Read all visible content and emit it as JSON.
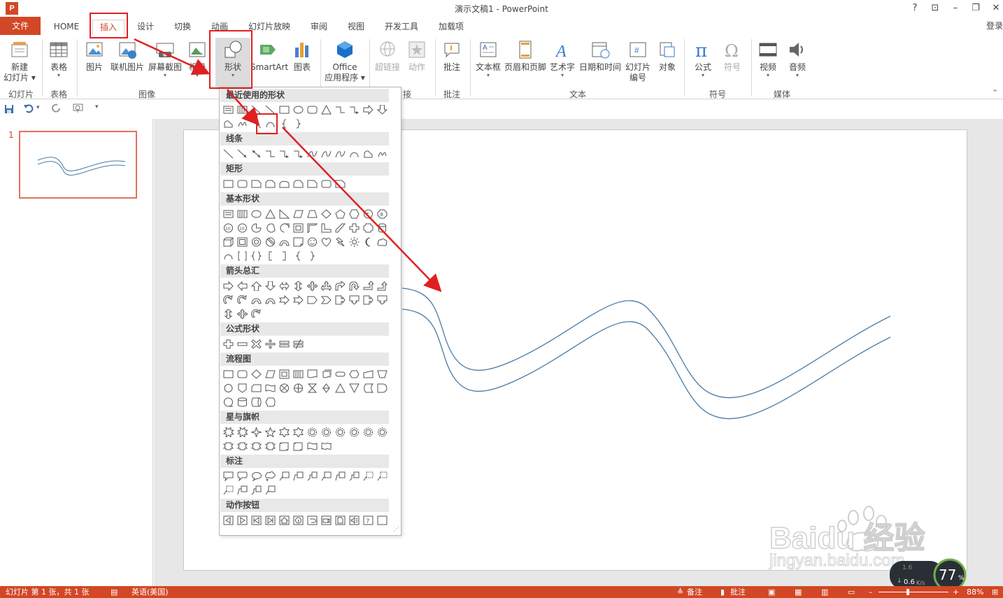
{
  "window": {
    "title": "演示文稿1 - PowerPoint",
    "help": "?",
    "restore_ribbon": "⊡",
    "minimize": "–",
    "maximize": "❐",
    "close": "✕"
  },
  "tabs": {
    "file": "文件",
    "home": "HOME",
    "insert": "插入",
    "design": "设计",
    "transitions": "切换",
    "animations": "动画",
    "slideshow": "幻灯片放映",
    "review": "审阅",
    "view": "视图",
    "developer": "开发工具",
    "addins": "加载项",
    "login": "登录"
  },
  "ribbon": {
    "new_slide": "新建",
    "new_slide2": "幻灯片 ▾",
    "table": "表格",
    "picture": "图片",
    "online_picture": "联机图片",
    "screenshot": "屏幕截图",
    "album": "相册",
    "shapes": "形状",
    "smartart": "SmartArt",
    "chart": "图表",
    "office": "Office",
    "office2": "应用程序 ▾",
    "hyperlink": "超链接",
    "action": "动作",
    "comment": "批注",
    "textbox": "文本框",
    "header_footer": "页眉和页脚",
    "wordart": "艺术字",
    "datetime": "日期和时间",
    "slide_number": "幻灯片",
    "slide_number2": "编号",
    "object": "对象",
    "equation": "公式",
    "symbol": "符号",
    "video": "视频",
    "audio": "音频",
    "groups": {
      "slides": "幻灯片",
      "tables": "表格",
      "images": "图像",
      "links": "接",
      "comments": "批注",
      "text": "文本",
      "symbols": "符号",
      "media": "媒体"
    }
  },
  "shapes_menu": {
    "sections": {
      "recent": "最近使用的形状",
      "lines": "线条",
      "rect": "矩形",
      "basic": "基本形状",
      "arrows": "箭头总汇",
      "equation": "公式形状",
      "flowchart": "流程图",
      "stars": "星与旗帜",
      "callouts": "标注",
      "action": "动作按钮"
    }
  },
  "thumbnail": {
    "number": "1"
  },
  "status": {
    "slide_info": "幻灯片 第 1 张，共 1 张",
    "language": "英语(美国)",
    "notes": "备注",
    "comments": "批注",
    "zoom": "88%"
  },
  "badge": {
    "percent": "77",
    "percent_sign": "%",
    "speed": "0.6",
    "speed_unit": "K/s",
    "top_speed": "1.6"
  },
  "watermark": {
    "brand": "Baidu 经验",
    "url": "jingyan.baidu.com"
  },
  "colors": {
    "accent": "#d24726",
    "highlight": "#e02020",
    "curve": "#4a7ba6"
  }
}
